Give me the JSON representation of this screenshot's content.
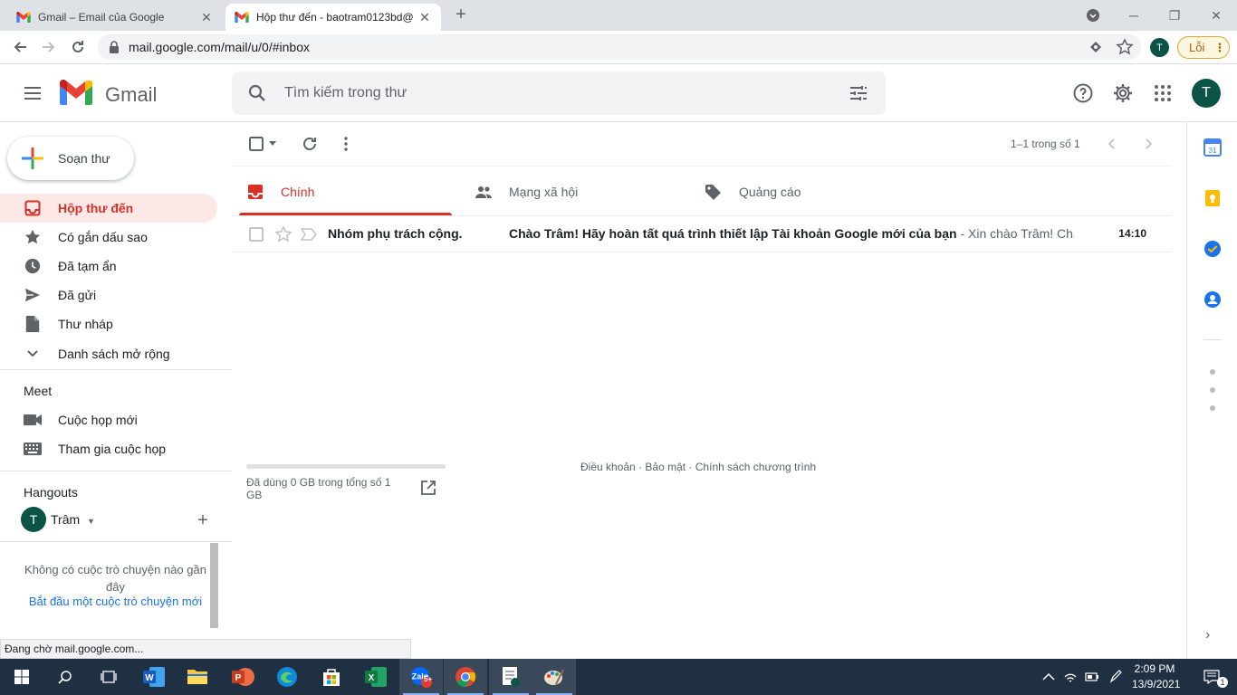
{
  "browser": {
    "tabs": [
      {
        "title": "Gmail – Email của Google",
        "active": false
      },
      {
        "title": "Hộp thư đến - baotram0123bd@",
        "active": true
      }
    ],
    "url": "mail.google.com/mail/u/0/#inbox",
    "profile_initial": "T",
    "error_chip": "Lỗi"
  },
  "header": {
    "app_name": "Gmail",
    "search_placeholder": "Tìm kiếm trong thư",
    "avatar_initial": "T"
  },
  "sidebar": {
    "compose_label": "Soạn thư",
    "items": [
      {
        "label": "Hộp thư đến",
        "icon": "inbox-icon",
        "active": true
      },
      {
        "label": "Có gắn dấu sao",
        "icon": "star-icon"
      },
      {
        "label": "Đã tạm ẩn",
        "icon": "clock-icon"
      },
      {
        "label": "Đã gửi",
        "icon": "send-icon"
      },
      {
        "label": "Thư nháp",
        "icon": "draft-icon"
      },
      {
        "label": "Danh sách mở rộng",
        "icon": "chevron-down-icon"
      }
    ],
    "meet": {
      "title": "Meet",
      "items": [
        {
          "label": "Cuộc họp mới",
          "icon": "video-icon"
        },
        {
          "label": "Tham gia cuộc họp",
          "icon": "keyboard-icon"
        }
      ]
    },
    "hangouts": {
      "title": "Hangouts",
      "user_initial": "T",
      "user_name": "Trâm",
      "empty_text": "Không có cuộc trò chuyện nào gần đây",
      "start_link": "Bắt đầu một cuộc trò chuyện mới"
    }
  },
  "main": {
    "pager": "1–1 trong số 1",
    "category_tabs": [
      {
        "label": "Chính",
        "icon": "inbox-icon",
        "active": true
      },
      {
        "label": "Mạng xã hội",
        "icon": "people-icon"
      },
      {
        "label": "Quảng cáo",
        "icon": "tag-icon"
      }
    ],
    "emails": [
      {
        "sender": "Nhóm phụ trách cộng.",
        "subject": "Chào Trâm! Hãy hoàn tất quá trình thiết lập Tài khoản Google mới của bạn",
        "snippet": " - Xin chào Trâm! Chà...",
        "time": "14:10"
      }
    ],
    "storage_text": "Đã dùng 0 GB trong tổng số 1 GB",
    "storage_fraction": 0.0,
    "footer": {
      "terms": "Điều khoản",
      "privacy": "Bảo mật",
      "policy": "Chính sách chương trình",
      "sep": " · "
    }
  },
  "status_text": "Đang chờ mail.google.com...",
  "taskbar": {
    "time": "2:09 PM",
    "date": "13/9/2021",
    "notification_count": "1",
    "zalo_badge": "5+"
  },
  "colors": {
    "accent_red": "#d93025",
    "active_bg": "#fce8e6",
    "avatar_green": "#0b5345",
    "taskbar": "#1f3043"
  }
}
